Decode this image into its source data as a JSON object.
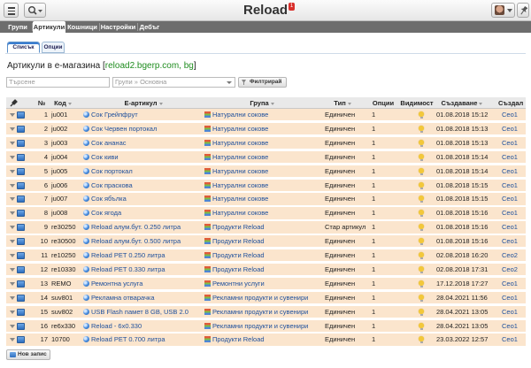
{
  "app": {
    "title": "Reload",
    "notification_count": "1"
  },
  "nav": {
    "tabs": [
      "Групи",
      "Артикули",
      "Кошници",
      "Настройки",
      "Дебъг"
    ],
    "active": "Артикули"
  },
  "subtabs": {
    "items": [
      "Списък",
      "Опции"
    ],
    "active": "Списък"
  },
  "page": {
    "heading": "Артикули в е-магазина",
    "heading_link": "reload2.bgerp.com, bg"
  },
  "filters": {
    "search_placeholder": "Търсене",
    "group_placeholder": "Групи » Основна",
    "filter_button": "Филтрирай"
  },
  "table": {
    "headers": [
      "№",
      "Код",
      "Е-артикул",
      "Група",
      "Тип",
      "Опции",
      "Видимост",
      "Създаване",
      "Създал"
    ],
    "rows": [
      {
        "n": "1",
        "code": "ju001",
        "name": "Сок Грейпфрут",
        "group": "Натурални сокове",
        "type": "Единичен",
        "options": "1",
        "created": "01.08.2018 15:12",
        "by": "Ceo1"
      },
      {
        "n": "2",
        "code": "ju002",
        "name": "Сок Червен портокал",
        "group": "Натурални сокове",
        "type": "Единичен",
        "options": "1",
        "created": "01.08.2018 15:13",
        "by": "Ceo1"
      },
      {
        "n": "3",
        "code": "ju003",
        "name": "Сок ананас",
        "group": "Натурални сокове",
        "type": "Единичен",
        "options": "1",
        "created": "01.08.2018 15:13",
        "by": "Ceo1"
      },
      {
        "n": "4",
        "code": "ju004",
        "name": "Сок киви",
        "group": "Натурални сокове",
        "type": "Единичен",
        "options": "1",
        "created": "01.08.2018 15:14",
        "by": "Ceo1"
      },
      {
        "n": "5",
        "code": "ju005",
        "name": "Сок портокал",
        "group": "Натурални сокове",
        "type": "Единичен",
        "options": "1",
        "created": "01.08.2018 15:14",
        "by": "Ceo1"
      },
      {
        "n": "6",
        "code": "ju006",
        "name": "Сок праскова",
        "group": "Натурални сокове",
        "type": "Единичен",
        "options": "1",
        "created": "01.08.2018 15:15",
        "by": "Ceo1"
      },
      {
        "n": "7",
        "code": "ju007",
        "name": "Сок ябълка",
        "group": "Натурални сокове",
        "type": "Единичен",
        "options": "1",
        "created": "01.08.2018 15:15",
        "by": "Ceo1"
      },
      {
        "n": "8",
        "code": "ju008",
        "name": "Сок ягода",
        "group": "Натурални сокове",
        "type": "Единичен",
        "options": "1",
        "created": "01.08.2018 15:16",
        "by": "Ceo1"
      },
      {
        "n": "9",
        "code": "re30250",
        "name": "Reload алум.бут. 0.250 литра",
        "group": "Продукти Reload",
        "type": "Стар артикул",
        "options": "1",
        "created": "01.08.2018 15:16",
        "by": "Ceo1"
      },
      {
        "n": "10",
        "code": "re30500",
        "name": "Reload алум.бут. 0.500 литра",
        "group": "Продукти Reload",
        "type": "Единичен",
        "options": "1",
        "created": "01.08.2018 15:16",
        "by": "Ceo1"
      },
      {
        "n": "11",
        "code": "re10250",
        "name": "Reload PET 0.250 литра",
        "group": "Продукти Reload",
        "type": "Единичен",
        "options": "1",
        "created": "02.08.2018 16:20",
        "by": "Ceo2"
      },
      {
        "n": "12",
        "code": "re10330",
        "name": "Reload PET 0.330 литра",
        "group": "Продукти Reload",
        "type": "Единичен",
        "options": "1",
        "created": "02.08.2018 17:31",
        "by": "Ceo2"
      },
      {
        "n": "13",
        "code": "REMO",
        "name": "Ремонтна услуга",
        "group": "Ремонтни услуги",
        "type": "Единичен",
        "options": "1",
        "created": "17.12.2018 17:27",
        "by": "Ceo1"
      },
      {
        "n": "14",
        "code": "suv801",
        "name": "Рекламна отварачка",
        "group": "Рекламни продукти и сувенири",
        "type": "Единичен",
        "options": "1",
        "created": "28.04.2021 11:56",
        "by": "Ceo1"
      },
      {
        "n": "15",
        "code": "suv802",
        "name": "USB Flash памет 8 GB, USB 2.0",
        "group": "Рекламни продукти и сувенири",
        "type": "Единичен",
        "options": "1",
        "created": "28.04.2021 13:05",
        "by": "Ceo1"
      },
      {
        "n": "16",
        "code": "re6x330",
        "name": "Reload - 6x0.330",
        "group": "Рекламни продукти и сувенири",
        "type": "Единичен",
        "options": "1",
        "created": "28.04.2021 13:05",
        "by": "Ceo1"
      },
      {
        "n": "17",
        "code": "10700",
        "name": "Reload PET 0.700 литра",
        "group": "Продукти Reload",
        "type": "Единичен",
        "options": "1",
        "created": "23.03.2022 12:57",
        "by": "Ceo1"
      }
    ]
  },
  "footer": {
    "new_button": "Нов запис"
  }
}
